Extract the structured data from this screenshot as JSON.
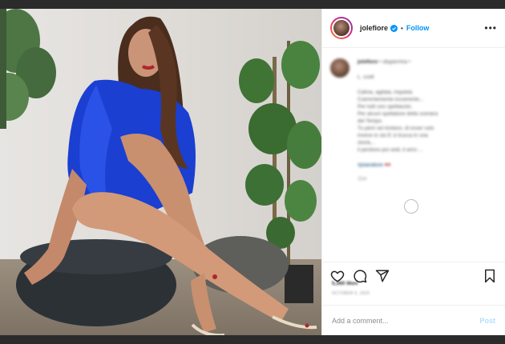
{
  "post": {
    "username": "jolefiore",
    "separator": "•",
    "follow_label": "Follow",
    "more_label": "•••"
  },
  "comments": {
    "author": "jolefiore",
    "author_suffix": "• ubyperrina •",
    "lines": [
      "L. ccelt",
      "",
      "Calma, agitata, inquieta",
      "Coerentemente incoerente...",
      "Per tutti uno spettacolo.",
      "Per alcuni spettatore della scenera",
      "del Tempo.",
      "Tu però sei lontano, di esser solo",
      "invece io sto E si trucca in una",
      "storia...",
      "il perdono poi vedi, ti amo ..."
    ],
    "hashtag": "#jolandiore",
    "meta": "11w"
  },
  "stats": {
    "likes": "5,360 likes",
    "date": "OCTOBER 5, 2020"
  },
  "comment_box": {
    "placeholder": "Add a comment...",
    "post_label": "Post"
  },
  "colors": {
    "accent": "#0095f6",
    "post_disabled": "#b2dffc",
    "dress": "#1a3fd1"
  },
  "icons": [
    "more-options-icon",
    "verified-badge-icon",
    "heart-icon",
    "comment-icon",
    "share-icon",
    "bookmark-icon"
  ]
}
